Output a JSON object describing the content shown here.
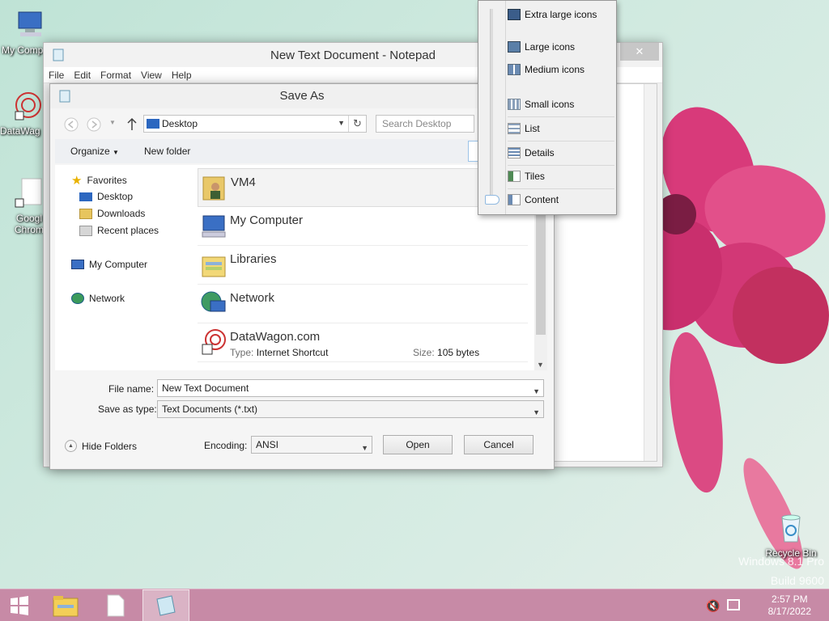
{
  "desktop": {
    "icons": [
      {
        "label": "My Comp"
      },
      {
        "label": "DataWag"
      },
      {
        "label": "Googl Chrom"
      }
    ],
    "recycle_bin_label": "Recycle Bin",
    "watermark_line1": "Windows 8.1 Pro",
    "watermark_line2": "Build 9600"
  },
  "notepad": {
    "title": "New Text Document - Notepad",
    "menu": [
      "File",
      "Edit",
      "Format",
      "View",
      "Help"
    ],
    "close_glyph": "✕"
  },
  "dialog": {
    "title": "Save As",
    "address": "Desktop",
    "search_placeholder": "Search Desktop",
    "organize_label": "Organize",
    "new_folder_label": "New folder",
    "nav": {
      "favorites": "Favorites",
      "desktop": "Desktop",
      "downloads": "Downloads",
      "recent": "Recent places",
      "computer": "My Computer",
      "network": "Network"
    },
    "files": [
      {
        "name": "VM4"
      },
      {
        "name": "My Computer"
      },
      {
        "name": "Libraries"
      },
      {
        "name": "Network"
      },
      {
        "name": "DataWagon.com",
        "type_label": "Type:",
        "type_value": "Internet Shortcut",
        "size_label": "Size:",
        "size_value": "105 bytes"
      }
    ],
    "file_name_label": "File name:",
    "file_name_value": "New Text Document",
    "save_type_label": "Save as type:",
    "save_type_value": "Text Documents (*.txt)",
    "hide_folders_label": "Hide Folders",
    "encoding_label": "Encoding:",
    "encoding_value": "ANSI",
    "open_label": "Open",
    "cancel_label": "Cancel"
  },
  "view_menu": {
    "items": [
      "Extra large icons",
      "Large icons",
      "Medium icons",
      "Small icons",
      "List",
      "Details",
      "Tiles",
      "Content"
    ]
  },
  "taskbar": {
    "time": "2:57 PM",
    "date": "8/17/2022"
  },
  "colors": {
    "taskbar": "#c78aa6",
    "flower": "#e0457f",
    "desktop_bg": "#cfe9df"
  }
}
